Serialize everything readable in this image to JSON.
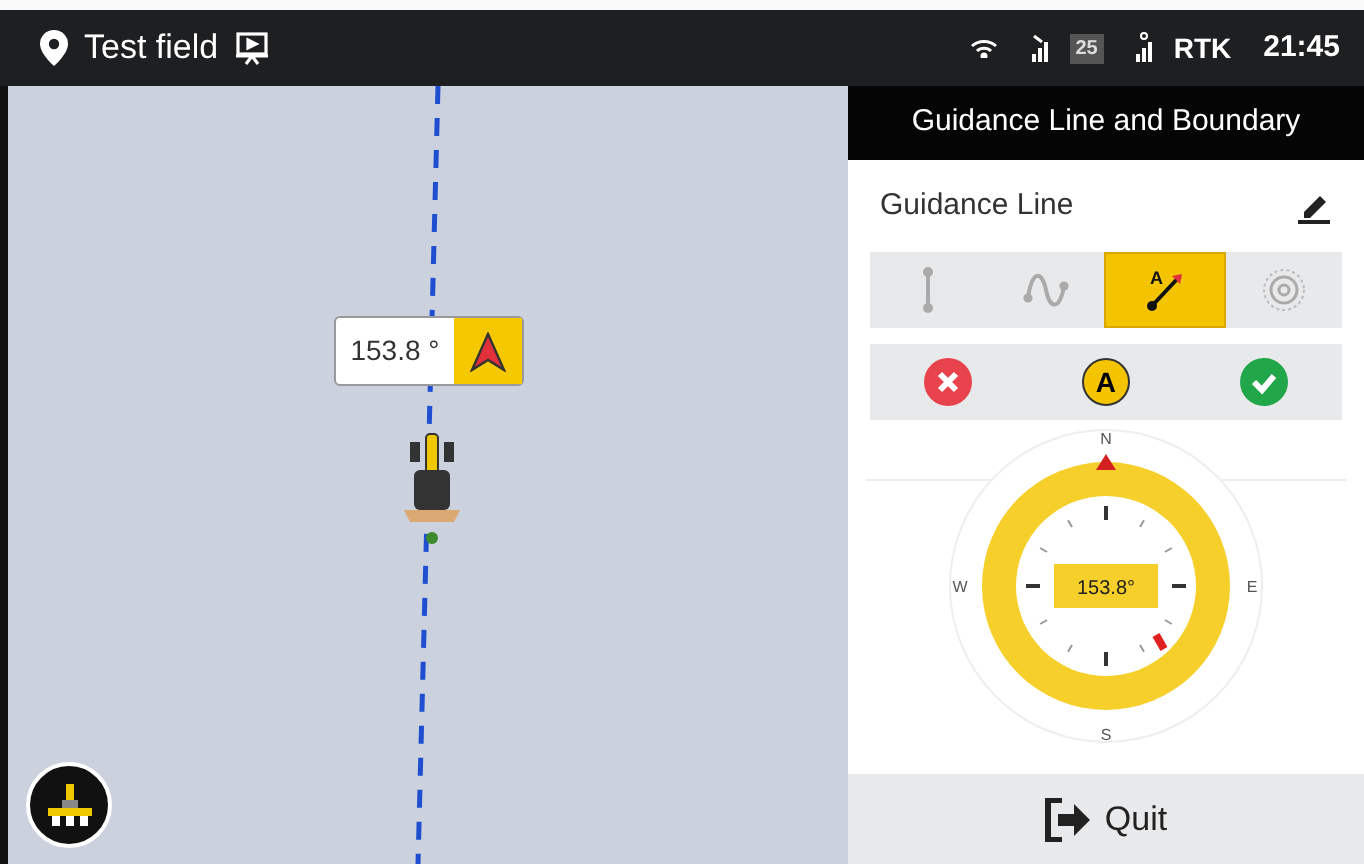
{
  "status_bar": {
    "field_name": "Test field",
    "sat_count": "25",
    "correction": "RTK",
    "time": "21:45"
  },
  "map": {
    "heading": "153.8 °"
  },
  "panel": {
    "title": "Guidance Line and Boundary",
    "section_title": "Guidance Line",
    "line_types": [
      {
        "kind": "straight",
        "selected": false
      },
      {
        "kind": "curve",
        "selected": false
      },
      {
        "kind": "ab",
        "selected": true,
        "marker": "A"
      },
      {
        "kind": "pivot",
        "selected": false
      }
    ],
    "point_label": "A",
    "compass": {
      "north": "N",
      "east": "E",
      "south": "S",
      "west": "W",
      "heading": "153.8°"
    },
    "quit": "Quit"
  }
}
